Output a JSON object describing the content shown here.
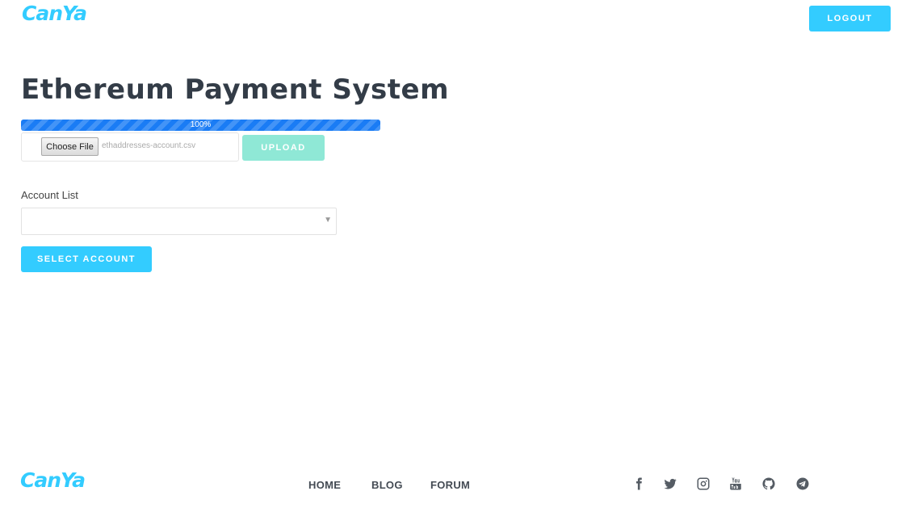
{
  "header": {
    "logo_text": "CanYa",
    "logout_label": "LOGOUT"
  },
  "main": {
    "title": "Ethereum Payment System",
    "upload": {
      "progress_percent": 100,
      "progress_label": "100%",
      "choose_file_label": "Choose File",
      "file_name": "ethaddresses-account.csv",
      "upload_label": "UPLOAD"
    },
    "account_list": {
      "label": "Account List",
      "selected_value": ""
    },
    "select_account_label": "SELECT ACCOUNT"
  },
  "footer": {
    "logo_text": "CanYa",
    "nav": [
      "HOME",
      "BLOG",
      "FORUM"
    ],
    "social_icons": [
      "facebook-icon",
      "twitter-icon",
      "instagram-icon",
      "youtube-icon",
      "github-icon",
      "telegram-icon"
    ]
  },
  "colors": {
    "accent": "#33ccff",
    "upload_button": "#8fe8d6",
    "progress": "#1a7cf5",
    "title": "#333c47"
  }
}
